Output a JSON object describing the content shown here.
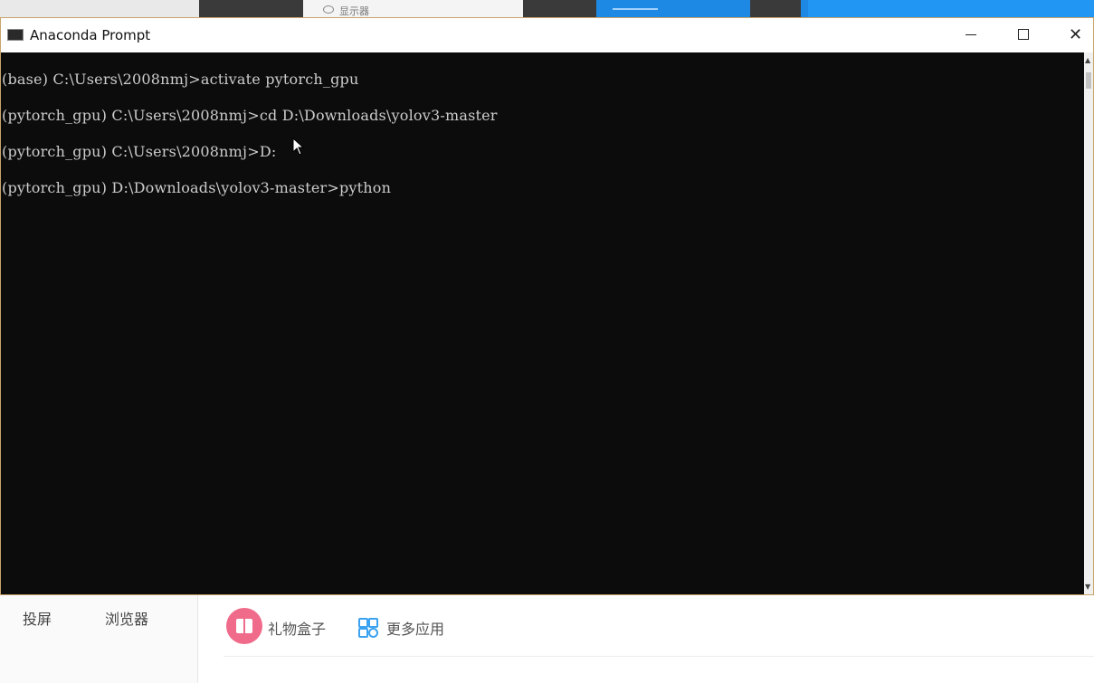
{
  "window": {
    "title": "Anaconda Prompt",
    "close_glyph": "✕"
  },
  "console": {
    "lines": [
      "(base) C:\\Users\\2008nmj>activate pytorch_gpu",
      "(pytorch_gpu) C:\\Users\\2008nmj>cd D:\\Downloads\\yolov3-master",
      "(pytorch_gpu) C:\\Users\\2008nmj>D:",
      "(pytorch_gpu) D:\\Downloads\\yolov3-master>python"
    ]
  },
  "background_app": {
    "top_label": "显示器",
    "left_items": [
      "投屏",
      "浏览器"
    ],
    "apps": [
      {
        "label": "礼物盒子",
        "icon": "gift-icon"
      },
      {
        "label": "更多应用",
        "icon": "grid-icon"
      }
    ]
  },
  "colors": {
    "console_bg": "#0c0c0c",
    "console_text": "#cccccc",
    "gift_icon": "#f06a8a",
    "grid_icon": "#3ba2f0"
  }
}
